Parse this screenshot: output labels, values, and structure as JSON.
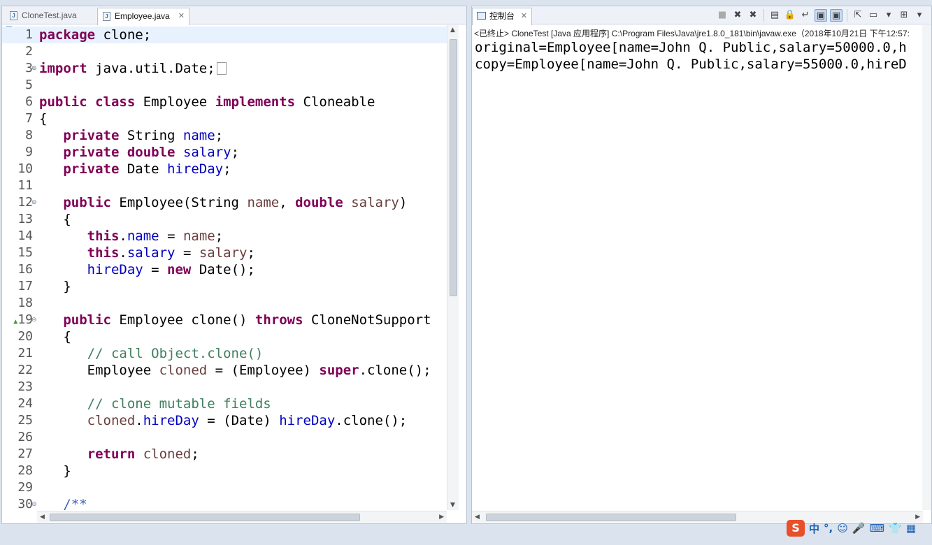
{
  "editor": {
    "tabs": [
      {
        "label": "CloneTest.java",
        "active": false
      },
      {
        "label": "Employee.java",
        "active": true
      }
    ],
    "lines": [
      {
        "n": "1",
        "html_key": "l1"
      },
      {
        "n": "2"
      },
      {
        "n": "3"
      },
      {
        "n": "5"
      },
      {
        "n": "6"
      },
      {
        "n": "7"
      },
      {
        "n": "8"
      },
      {
        "n": "9"
      },
      {
        "n": "10"
      },
      {
        "n": "11"
      },
      {
        "n": "12"
      },
      {
        "n": "13"
      },
      {
        "n": "14"
      },
      {
        "n": "15"
      },
      {
        "n": "16"
      },
      {
        "n": "17"
      },
      {
        "n": "18"
      },
      {
        "n": "19"
      },
      {
        "n": "20"
      },
      {
        "n": "21"
      },
      {
        "n": "22"
      },
      {
        "n": "23"
      },
      {
        "n": "24"
      },
      {
        "n": "25"
      },
      {
        "n": "26"
      },
      {
        "n": "27"
      },
      {
        "n": "28"
      },
      {
        "n": "29"
      },
      {
        "n": "30"
      }
    ],
    "code": {
      "l1_kw": "package",
      "l1_rest": " clone;",
      "l3_kw": "import",
      "l3_rest": " java.util.Date;",
      "l6_kw1": "public",
      "l6_kw2": "class",
      "l6_name": " Employee ",
      "l6_kw3": "implements",
      "l6_rest": " Cloneable",
      "l7": "{",
      "l8_kw": "private",
      "l8_type": " String ",
      "l8_fld": "name",
      "l8_end": ";",
      "l9_kw1": "private",
      "l9_kw2": "double",
      "l9_fld": "salary",
      "l9_end": ";",
      "l10_kw": "private",
      "l10_type": " Date ",
      "l10_fld": "hireDay",
      "l10_end": ";",
      "l12_kw": "public",
      "l12_a": " Employee(String ",
      "l12_p1": "name",
      "l12_b": ", ",
      "l12_kw2": "double",
      "l12_p2": "salary",
      "l12_c": ")",
      "l13": "{",
      "l14_kw": "this",
      "l14_dot": ".",
      "l14_fld": "name",
      "l14_eq": " = ",
      "l14_par": "name",
      "l14_end": ";",
      "l15_kw": "this",
      "l15_dot": ".",
      "l15_fld": "salary",
      "l15_eq": " = ",
      "l15_par": "salary",
      "l15_end": ";",
      "l16_fld": "hireDay",
      "l16_eq": " = ",
      "l16_kw": "new",
      "l16_rest": " Date();",
      "l17": "}",
      "l19_kw": "public",
      "l19_a": " Employee clone() ",
      "l19_kw2": "throws",
      "l19_rest": " CloneNotSupport",
      "l20": "{",
      "l21": "// call Object.clone()",
      "l22_a": "Employee ",
      "l22_var": "cloned",
      "l22_b": " = (Employee) ",
      "l22_kw": "super",
      "l22_rest": ".clone();",
      "l24": "// clone mutable fields",
      "l25_var": "cloned",
      "l25_dot": ".",
      "l25_fld": "hireDay",
      "l25_b": " = (Date) ",
      "l25_fld2": "hireDay",
      "l25_rest": ".clone();",
      "l27_kw": "return",
      "l27_var": " cloned",
      "l27_end": ";",
      "l28": "}",
      "l30": "/**"
    }
  },
  "console": {
    "tab_label": "控制台",
    "status": "<已终止> CloneTest [Java 应用程序] C:\\Program Files\\Java\\jre1.8.0_181\\bin\\javaw.exe（2018年10月21日 下午12:57:",
    "output": [
      "original=Employee[name=John Q. Public,salary=50000.0,h",
      "copy=Employee[name=John Q. Public,salary=55000.0,hireD"
    ]
  },
  "ime": {
    "logo": "S",
    "items": [
      "中",
      "°,",
      "☺",
      "🎤",
      "⌨",
      "👕",
      "▦"
    ]
  }
}
